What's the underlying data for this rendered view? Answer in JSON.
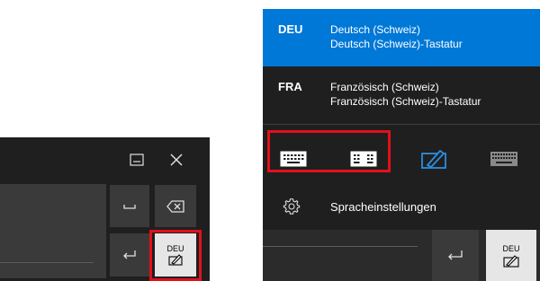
{
  "left_keyboard": {
    "deu_key_label": "DEU"
  },
  "language_menu": {
    "items": [
      {
        "code": "DEU",
        "name": "Deutsch (Schweiz)",
        "layout": "Deutsch (Schweiz)-Tastatur",
        "selected": true
      },
      {
        "code": "FRA",
        "name": "Französisch (Schweiz)",
        "layout": "Französisch (Schweiz)-Tastatur",
        "selected": false
      }
    ],
    "keyboard_layouts": [
      {
        "icon": "keyboard-standard-icon"
      },
      {
        "icon": "keyboard-split-icon"
      },
      {
        "icon": "handwriting-pen-icon"
      },
      {
        "icon": "keyboard-full-icon"
      }
    ],
    "settings_label": "Spracheinstellungen",
    "deu_key_label": "DEU"
  },
  "colors": {
    "accent": "#0078d7",
    "panel_bg": "#1f1f1f",
    "key_bg": "#3a3a3a",
    "highlight": "#e3101a"
  }
}
